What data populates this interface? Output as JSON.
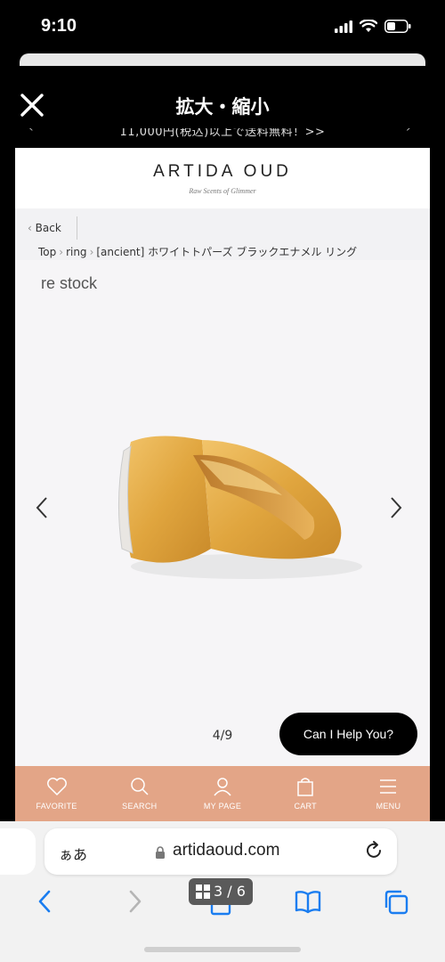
{
  "status_bar": {
    "time": "9:10"
  },
  "zoom_header": {
    "title": "拡大・縮小",
    "promo_text": "11,000円(税込)以上で送料無料！>>"
  },
  "site": {
    "brand": "ARTIDA OUD",
    "tagline": "Raw Scents of Glimmer",
    "back_label": "Back",
    "breadcrumb": [
      "Top",
      "ring",
      "[ancient] ホワイトトパーズ ブラックエナメル リング"
    ],
    "restock_label": "re stock",
    "image_counter": "4/9",
    "help_button": "Can I Help You?"
  },
  "bottom_nav": [
    {
      "label": "FAVORITE",
      "icon": "heart-icon"
    },
    {
      "label": "SEARCH",
      "icon": "search-icon"
    },
    {
      "label": "MY PAGE",
      "icon": "user-icon"
    },
    {
      "label": "CART",
      "icon": "bag-icon"
    },
    {
      "label": "MENU",
      "icon": "menu-icon"
    }
  ],
  "safari": {
    "aa_label": "ぁあ",
    "url": "artidaoud.com",
    "tab_count": "3 / 6"
  },
  "colors": {
    "nav_bg": "#e3a587",
    "accent_blue": "#1a7df0",
    "help_bg": "#000000"
  }
}
